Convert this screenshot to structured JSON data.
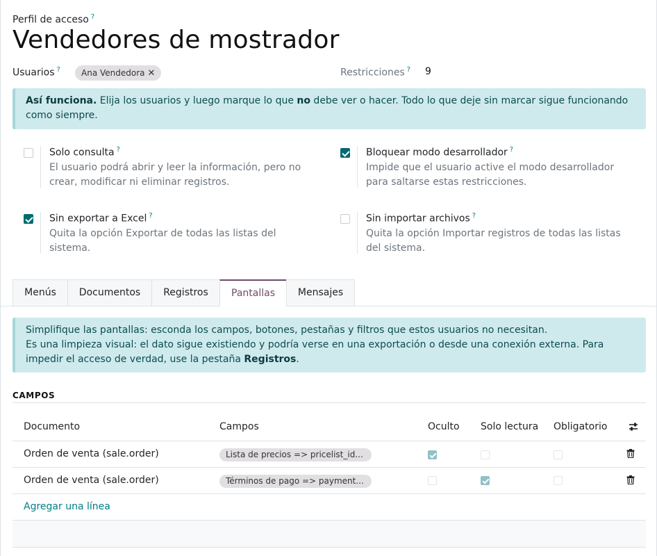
{
  "header": {
    "breadcrumb_label": "Perfil de acceso",
    "help_mark": "?",
    "title": "Vendedores de mostrador"
  },
  "users": {
    "label": "Usuarios",
    "tags": [
      "Ana Vendedora"
    ],
    "remove_glyph": "✕"
  },
  "restrictions": {
    "label": "Restricciones",
    "value": "9"
  },
  "info_top": {
    "bold_lead": "Así funciona.",
    "text_a": " Elija los usuarios y luego marque lo que ",
    "bold_no": "no",
    "text_b": " debe ver o hacer. Todo lo que deje sin marcar sigue funcionando como siempre."
  },
  "options": [
    {
      "title": "Solo consulta",
      "desc": "El usuario podrá abrir y leer la información, pero no crear, modificar ni eliminar registros.",
      "checked": false
    },
    {
      "title": "Bloquear modo desarrollador",
      "desc": "Impide que el usuario active el modo desarrollador para saltarse estas restricciones.",
      "checked": true
    },
    {
      "title": "Sin exportar a Excel",
      "desc": "Quita la opción Exportar de todas las listas del sistema.",
      "checked": true
    },
    {
      "title": "Sin importar archivos",
      "desc": "Quita la opción Importar registros de todas las listas del sistema.",
      "checked": false
    }
  ],
  "tabs": [
    {
      "label": "Menús",
      "active": false
    },
    {
      "label": "Documentos",
      "active": false
    },
    {
      "label": "Registros",
      "active": false
    },
    {
      "label": "Pantallas",
      "active": true
    },
    {
      "label": "Mensajes",
      "active": false
    }
  ],
  "info_screens": {
    "line1": "Simplifique las pantallas: esconda los campos, botones, pestañas y filtros que estos usuarios no necesitan.",
    "line2_a": "Es una limpieza visual: el dato sigue existiendo y podría verse en una exportación o desde una conexión externa. Para impedir el acceso de verdad, use la pestaña ",
    "line2_bold": "Registros",
    "line2_b": "."
  },
  "fields_section": {
    "title": "CAMPOS",
    "columns": [
      "Documento",
      "Campos",
      "Oculto",
      "Solo lectura",
      "Obligatorio"
    ],
    "rows": [
      {
        "document": "Orden de venta (sale.order)",
        "field": "Lista de precios => pricelist_id...",
        "hidden": true,
        "readonly": false,
        "required": false
      },
      {
        "document": "Orden de venta (sale.order)",
        "field": "Términos de pago => payment...",
        "hidden": false,
        "readonly": true,
        "required": false
      }
    ],
    "add_line": "Agregar una línea"
  },
  "colors": {
    "accent": "#714b67",
    "teal": "#017e84",
    "info_bg": "#cfeaec"
  }
}
